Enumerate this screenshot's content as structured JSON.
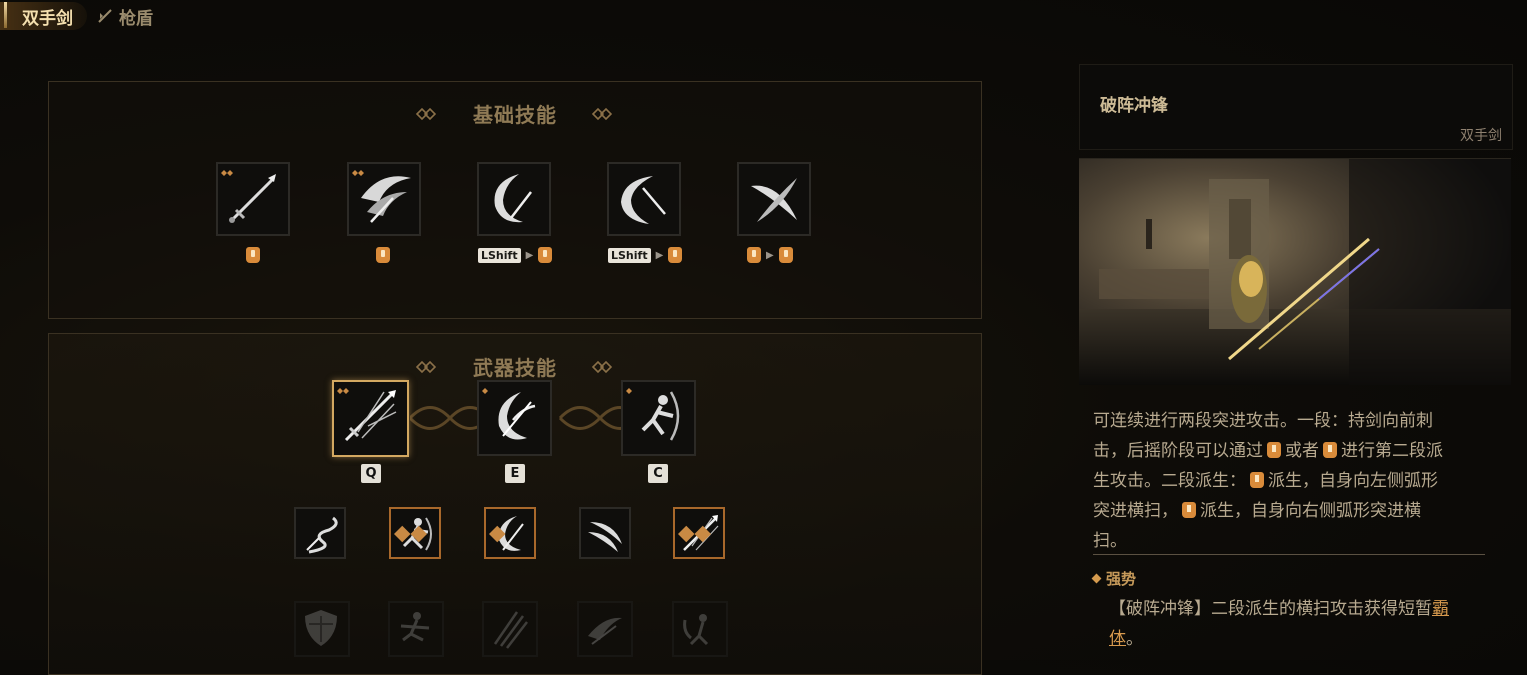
{
  "tabs": [
    {
      "label": "双手剑",
      "icon": "two-handed-sword-icon",
      "active": true
    },
    {
      "label": "枪盾",
      "icon": "spear-shield-icon",
      "active": false
    }
  ],
  "basic_skills": {
    "title": "基础技能",
    "skills": [
      {
        "icon": "sword-thrust-icon",
        "keys": [
          "mouse-left"
        ]
      },
      {
        "icon": "sword-slash-wave-icon",
        "keys": [
          "mouse-left"
        ]
      },
      {
        "icon": "crescent-sword-icon",
        "keys": [
          "LShift",
          "mouse-left"
        ]
      },
      {
        "icon": "crescent-sword-down-icon",
        "keys": [
          "LShift",
          "mouse-right"
        ]
      },
      {
        "icon": "cross-slash-icon",
        "keys": [
          "mouse-left",
          "mouse-right"
        ]
      }
    ]
  },
  "weapon_skills": {
    "title": "武器技能",
    "main": [
      {
        "icon": "charging-thrust-icon",
        "hotkey": "Q",
        "selected": true
      },
      {
        "icon": "spinning-blade-icon",
        "hotkey": "E",
        "selected": false
      },
      {
        "icon": "warrior-strike-icon",
        "hotkey": "C",
        "selected": false
      }
    ],
    "secondary": [
      {
        "icon": "serpent-blade-icon",
        "style": "plain"
      },
      {
        "icon": "warrior-leap-icon",
        "style": "orange"
      },
      {
        "icon": "spin-slash-icon",
        "style": "orange"
      },
      {
        "icon": "claw-slash-icon",
        "style": "plain"
      },
      {
        "icon": "arrow-thrust-icon",
        "style": "orange"
      }
    ],
    "locked": [
      {
        "icon": "shield-icon"
      },
      {
        "icon": "kneeling-guard-icon"
      },
      {
        "icon": "triple-slash-icon"
      },
      {
        "icon": "dash-slash-icon"
      },
      {
        "icon": "warrior-ward-icon"
      }
    ]
  },
  "detail": {
    "title": "破阵冲锋",
    "weapon": "双手剑",
    "desc_lines": [
      [
        "可连续进行两段突进攻击。一段：持剑向前刺"
      ],
      [
        "击，后摇阶段可以通过",
        "或者",
        "进行第二段派"
      ],
      [
        "生攻击。二段派生：",
        "派生，自身向左侧弧形"
      ],
      [
        "突进横扫，",
        "派生，自身向右侧弧形突进横"
      ],
      [
        "扫。"
      ]
    ],
    "trait_title": "强势",
    "trait_prefix": "【破阵冲锋】二段派生的横扫攻击获得短暂",
    "trait_highlight": "霸",
    "trait_line2_highlight": "体",
    "trait_suffix": "。"
  },
  "colors": {
    "accent_gold": "#d3a861",
    "mouse_key": "#d98b3a",
    "highlight": "#d79a4e"
  }
}
